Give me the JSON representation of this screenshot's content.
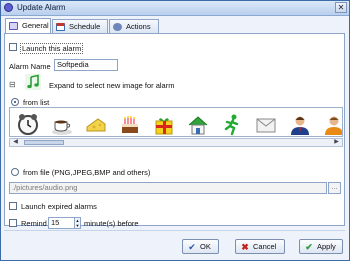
{
  "window": {
    "title": "Update Alarm",
    "close_glyph": "✕"
  },
  "tabs": [
    {
      "label": "General",
      "icon": "general-tab-icon",
      "active": true
    },
    {
      "label": "Schedule",
      "icon": "calendar-icon",
      "active": false
    },
    {
      "label": "Actions",
      "icon": "actions-gear-icon",
      "active": false
    }
  ],
  "general": {
    "launch_label": "Launch this alarm",
    "alarm_name_label": "Alarm Name",
    "alarm_name_value": "Softpedia",
    "expand_label": "Expand to select new image for alarm",
    "expand_glyph": "⊟",
    "from_list_label": "from list",
    "gallery_icons": [
      "clock-icon",
      "coffee-cup-icon",
      "cheese-icon",
      "birthday-cake-icon",
      "gift-icon",
      "house-icon",
      "running-man-icon",
      "envelope-icon",
      "person-icon",
      "person-orange-icon"
    ],
    "from_file_label": "from file (PNG,JPEG,BMP and others)",
    "file_path": "./pictures/audio.png",
    "browse_label": "...",
    "launch_expired_label": "Launch expired alarms",
    "remind_label": "Remind",
    "remind_value": "15",
    "remind_suffix": "minute(s) before"
  },
  "buttons": {
    "ok_label": "OK",
    "cancel_label": "Cancel",
    "apply_label": "Apply"
  },
  "colors": {
    "accent": "#3d6aa8",
    "music_note": "#2e9e3a"
  }
}
